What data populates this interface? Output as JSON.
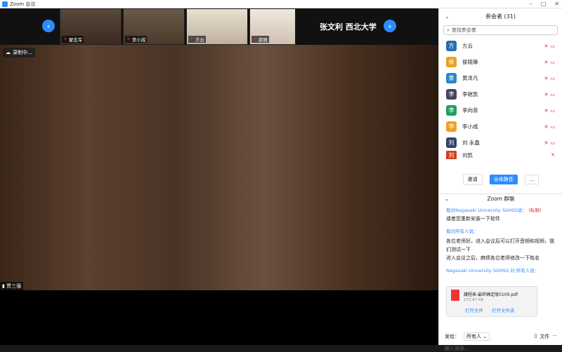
{
  "window": {
    "title": "Zoom 会议"
  },
  "strip": {
    "speaker_label": "张文利 西北大学",
    "tiles": [
      {
        "name": "翟志军"
      },
      {
        "name": "李小成"
      },
      {
        "name": "方云"
      },
      {
        "name": "邵展"
      }
    ]
  },
  "main": {
    "recording_label": "录制中...",
    "bottom_name": "贾三强"
  },
  "participants": {
    "title": "参会者 (31)",
    "search_placeholder": "查找参会者",
    "list": [
      {
        "avatar": "方",
        "name": "方云",
        "color": "#2b6cb0"
      },
      {
        "avatar": "侯",
        "name": "侯晓琳",
        "color": "#e8a020"
      },
      {
        "avatar": "黄",
        "name": "黄泽凡",
        "color": "#2b87c8"
      },
      {
        "avatar": "李",
        "name": "李继凯",
        "color": "#444466"
      },
      {
        "avatar": "李",
        "name": "李向菲",
        "color": "#20a060"
      },
      {
        "avatar": "李",
        "name": "李小成",
        "color": "#f0a020"
      },
      {
        "avatar": "刘",
        "name": "刘  永鑫",
        "color": "#334466"
      },
      {
        "avatar": "刘",
        "name": "刘凯",
        "color": "#d04020"
      }
    ],
    "invite_label": "邀请",
    "mute_all_label": "全体静音",
    "more_label": "..."
  },
  "chat": {
    "title": "Zoom 群聊",
    "messages": [
      {
        "from": "我对Nagasaki University SGHSS说：",
        "tag": "(私聊)",
        "text": "或者您重新安装一下软件"
      },
      {
        "from": "我对所有人说：",
        "tag": "",
        "text": "各位老师好，进入会议后可以打开音频和视频，我们测试一下"
      },
      {
        "from": "",
        "tag": "",
        "text": "进入会议之后，麻烦各位老师修改一下姓名"
      },
      {
        "from": "Nagasaki University SGHSS 对 所有人说：",
        "tag": "",
        "text": ""
      }
    ],
    "file": {
      "name": "議程表-最终确定版0109.pdf",
      "size": "172.87 KB",
      "open_label": "打开文件",
      "open_folder_label": "打开文件夹"
    },
    "send_to_label": "发给：",
    "recipient": "所有人",
    "file_button": "文件",
    "input_placeholder": "输入消息..."
  }
}
